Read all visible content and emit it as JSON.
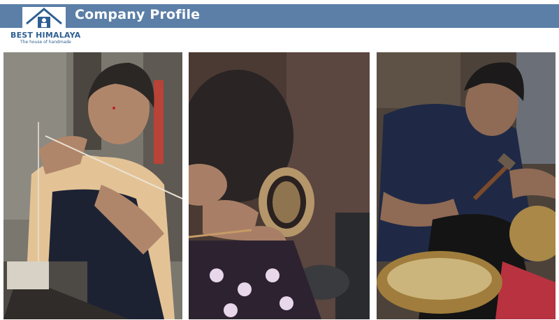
{
  "header": {
    "title": "Company Profile",
    "bar_color": "#5b7fa7"
  },
  "logo": {
    "brand": "BEST HIMALAYA",
    "tagline": "The house of handmade",
    "color": "#2f5f91"
  },
  "photos": [
    {
      "subject": "weaver-at-loom-photo"
    },
    {
      "subject": "singing-bowl-engraving-photo"
    },
    {
      "subject": "metalsmith-hammering-bowl-photo"
    }
  ]
}
